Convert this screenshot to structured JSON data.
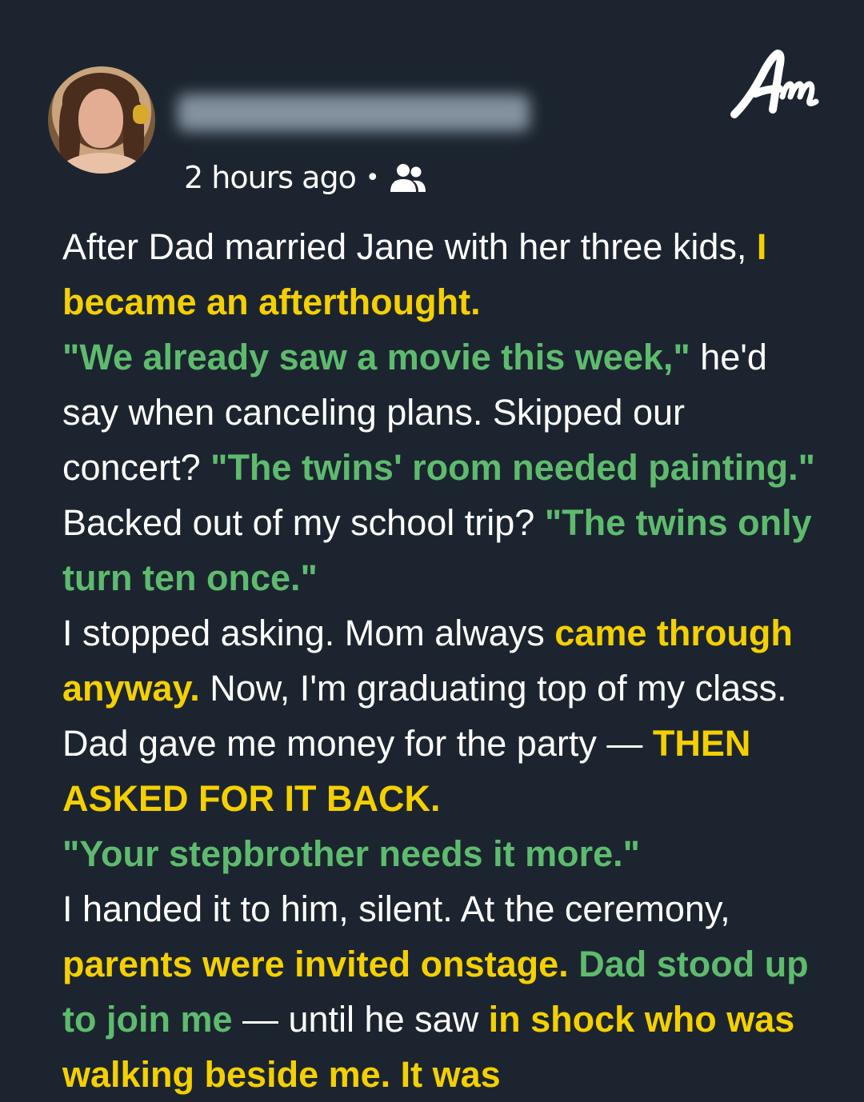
{
  "post": {
    "timestamp": "2 hours ago",
    "separator": "•",
    "audience_icon": "friends-group-icon"
  },
  "logo": {
    "text": "Am"
  },
  "colors": {
    "background": "#1c252f",
    "highlight_yellow": "#f5d000",
    "highlight_green": "#5ebb6e",
    "body_text": "#ffffff"
  },
  "story": {
    "s1": "After Dad married Jane with her three kids, ",
    "s2": "I became an afterthought.",
    "s3": "\"We already saw a movie this week,\"",
    "s4": " he'd say when canceling plans. Skipped our concert? ",
    "s5": "\"The twins' room needed painting.\"",
    "s6": " Backed out of my school trip? ",
    "s7": "\"The twins only turn ten once.\"",
    "s8": "I stopped asking. Mom always ",
    "s9": "came through anyway.",
    "s10": " Now, I'm graduating top of my class. Dad gave me money for the party — ",
    "s11": "THEN ASKED FOR IT BACK.",
    "s12": "\"Your stepbrother needs it more.\"",
    "s13": "I handed it to him, silent. At the ceremony, ",
    "s14": "parents were invited onstage.",
    "s15": " ",
    "s16": "Dad stood up to join me",
    "s17": " — until he saw ",
    "s18": "in shock who was walking beside me. It was"
  }
}
